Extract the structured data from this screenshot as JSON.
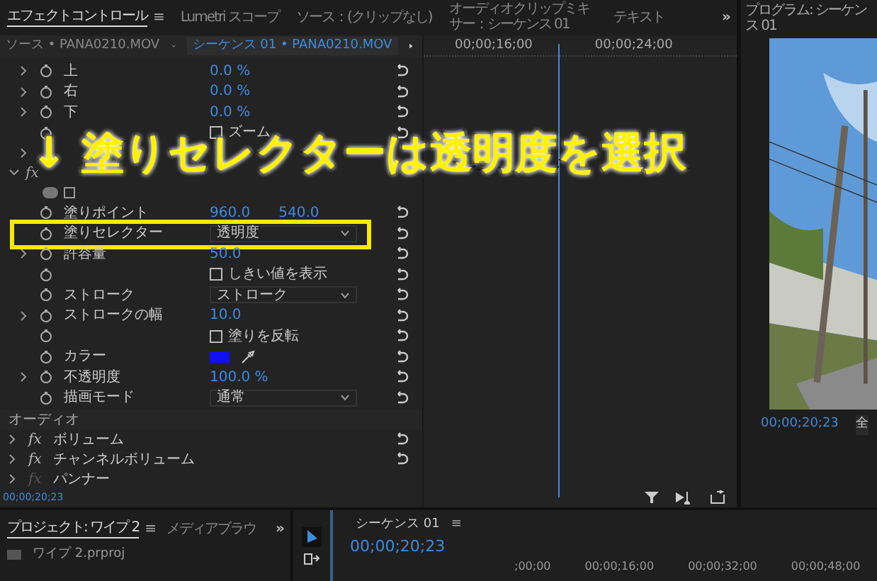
{
  "top_tabs": [
    {
      "label": "エフェクトコントロール",
      "selected": true,
      "menu": "≡"
    },
    {
      "label": "Lumetri スコープ",
      "selected": false
    },
    {
      "label": "ソース：(クリップなし)",
      "selected": false
    },
    {
      "label": "オーディオクリップミキサー：シーケンス 01",
      "selected": false
    },
    {
      "label": "テキスト",
      "selected": false
    }
  ],
  "overflow": "»",
  "source_bar": {
    "source": "ソース • PANA0210.MOV",
    "sequence": "シーケンス 01 • PANA0210.MOV"
  },
  "rows": [
    {
      "kind": "param",
      "label": "上",
      "value": "0.0 %",
      "expandable": true
    },
    {
      "kind": "param",
      "label": "右",
      "value": "0.0 %",
      "expandable": true
    },
    {
      "kind": "param",
      "label": "下",
      "value": "0.0 %",
      "expandable": true
    },
    {
      "kind": "checkbox",
      "label": "ズーム",
      "checked": false
    },
    {
      "kind": "hidden",
      "expandable": true
    },
    {
      "kind": "hidden_fx",
      "fx": "fx"
    },
    {
      "kind": "shapes"
    },
    {
      "kind": "param",
      "label": "塗りポイント",
      "value": "960.0",
      "value2": "540.0",
      "expandable": false
    },
    {
      "kind": "dropdown",
      "label": "塗りセレクター",
      "value": "透明度",
      "highlight": true
    },
    {
      "kind": "param",
      "label": "許容量",
      "value": "50.0",
      "expandable": true
    },
    {
      "kind": "checkbox",
      "label": "しきい値を表示",
      "checked": false
    },
    {
      "kind": "dropdown",
      "label": "ストローク",
      "value": "ストローク",
      "highlight": false
    },
    {
      "kind": "param",
      "label": "ストロークの幅",
      "value": "10.0",
      "expandable": true
    },
    {
      "kind": "checkbox",
      "label": "塗りを反転",
      "checked": false
    },
    {
      "kind": "color",
      "label": "カラー",
      "color": "#1010f0"
    },
    {
      "kind": "param",
      "label": "不透明度",
      "value": "100.0 %",
      "expandable": true
    },
    {
      "kind": "dropdown",
      "label": "描画モード",
      "value": "通常",
      "highlight": false
    }
  ],
  "audio": {
    "title": "オーディオ",
    "effects": [
      {
        "fx": "fx",
        "label": "ボリューム",
        "enabled": true
      },
      {
        "fx": "fx",
        "label": "チャンネルボリューム",
        "enabled": true
      },
      {
        "fx": "fx",
        "label": "パンナー",
        "enabled": false
      }
    ]
  },
  "effects_timecode": "00;00;20;23",
  "ruler": [
    "00;00;16;00",
    "00;00;24;00"
  ],
  "program": {
    "title": "プログラム: シーケンス 01",
    "timecode": "00;00;20;23",
    "fit": "全"
  },
  "annotation": "↓ 塗りセレクターは透明度を選択",
  "project": {
    "tabs": [
      {
        "label": "プロジェクト: ワイプ 2",
        "selected": true,
        "menu": "≡"
      },
      {
        "label": "メディアブラウ",
        "selected": false
      }
    ],
    "overflow": "»",
    "file": "ワイプ 2.prproj"
  },
  "timeline": {
    "title": "シーケンス 01",
    "menu": "≡",
    "timecode": "00;00;20;23",
    "ticks": [
      ";00;00",
      "00;00;16;00",
      "00;00;32;00",
      "00;00;48;00"
    ]
  }
}
